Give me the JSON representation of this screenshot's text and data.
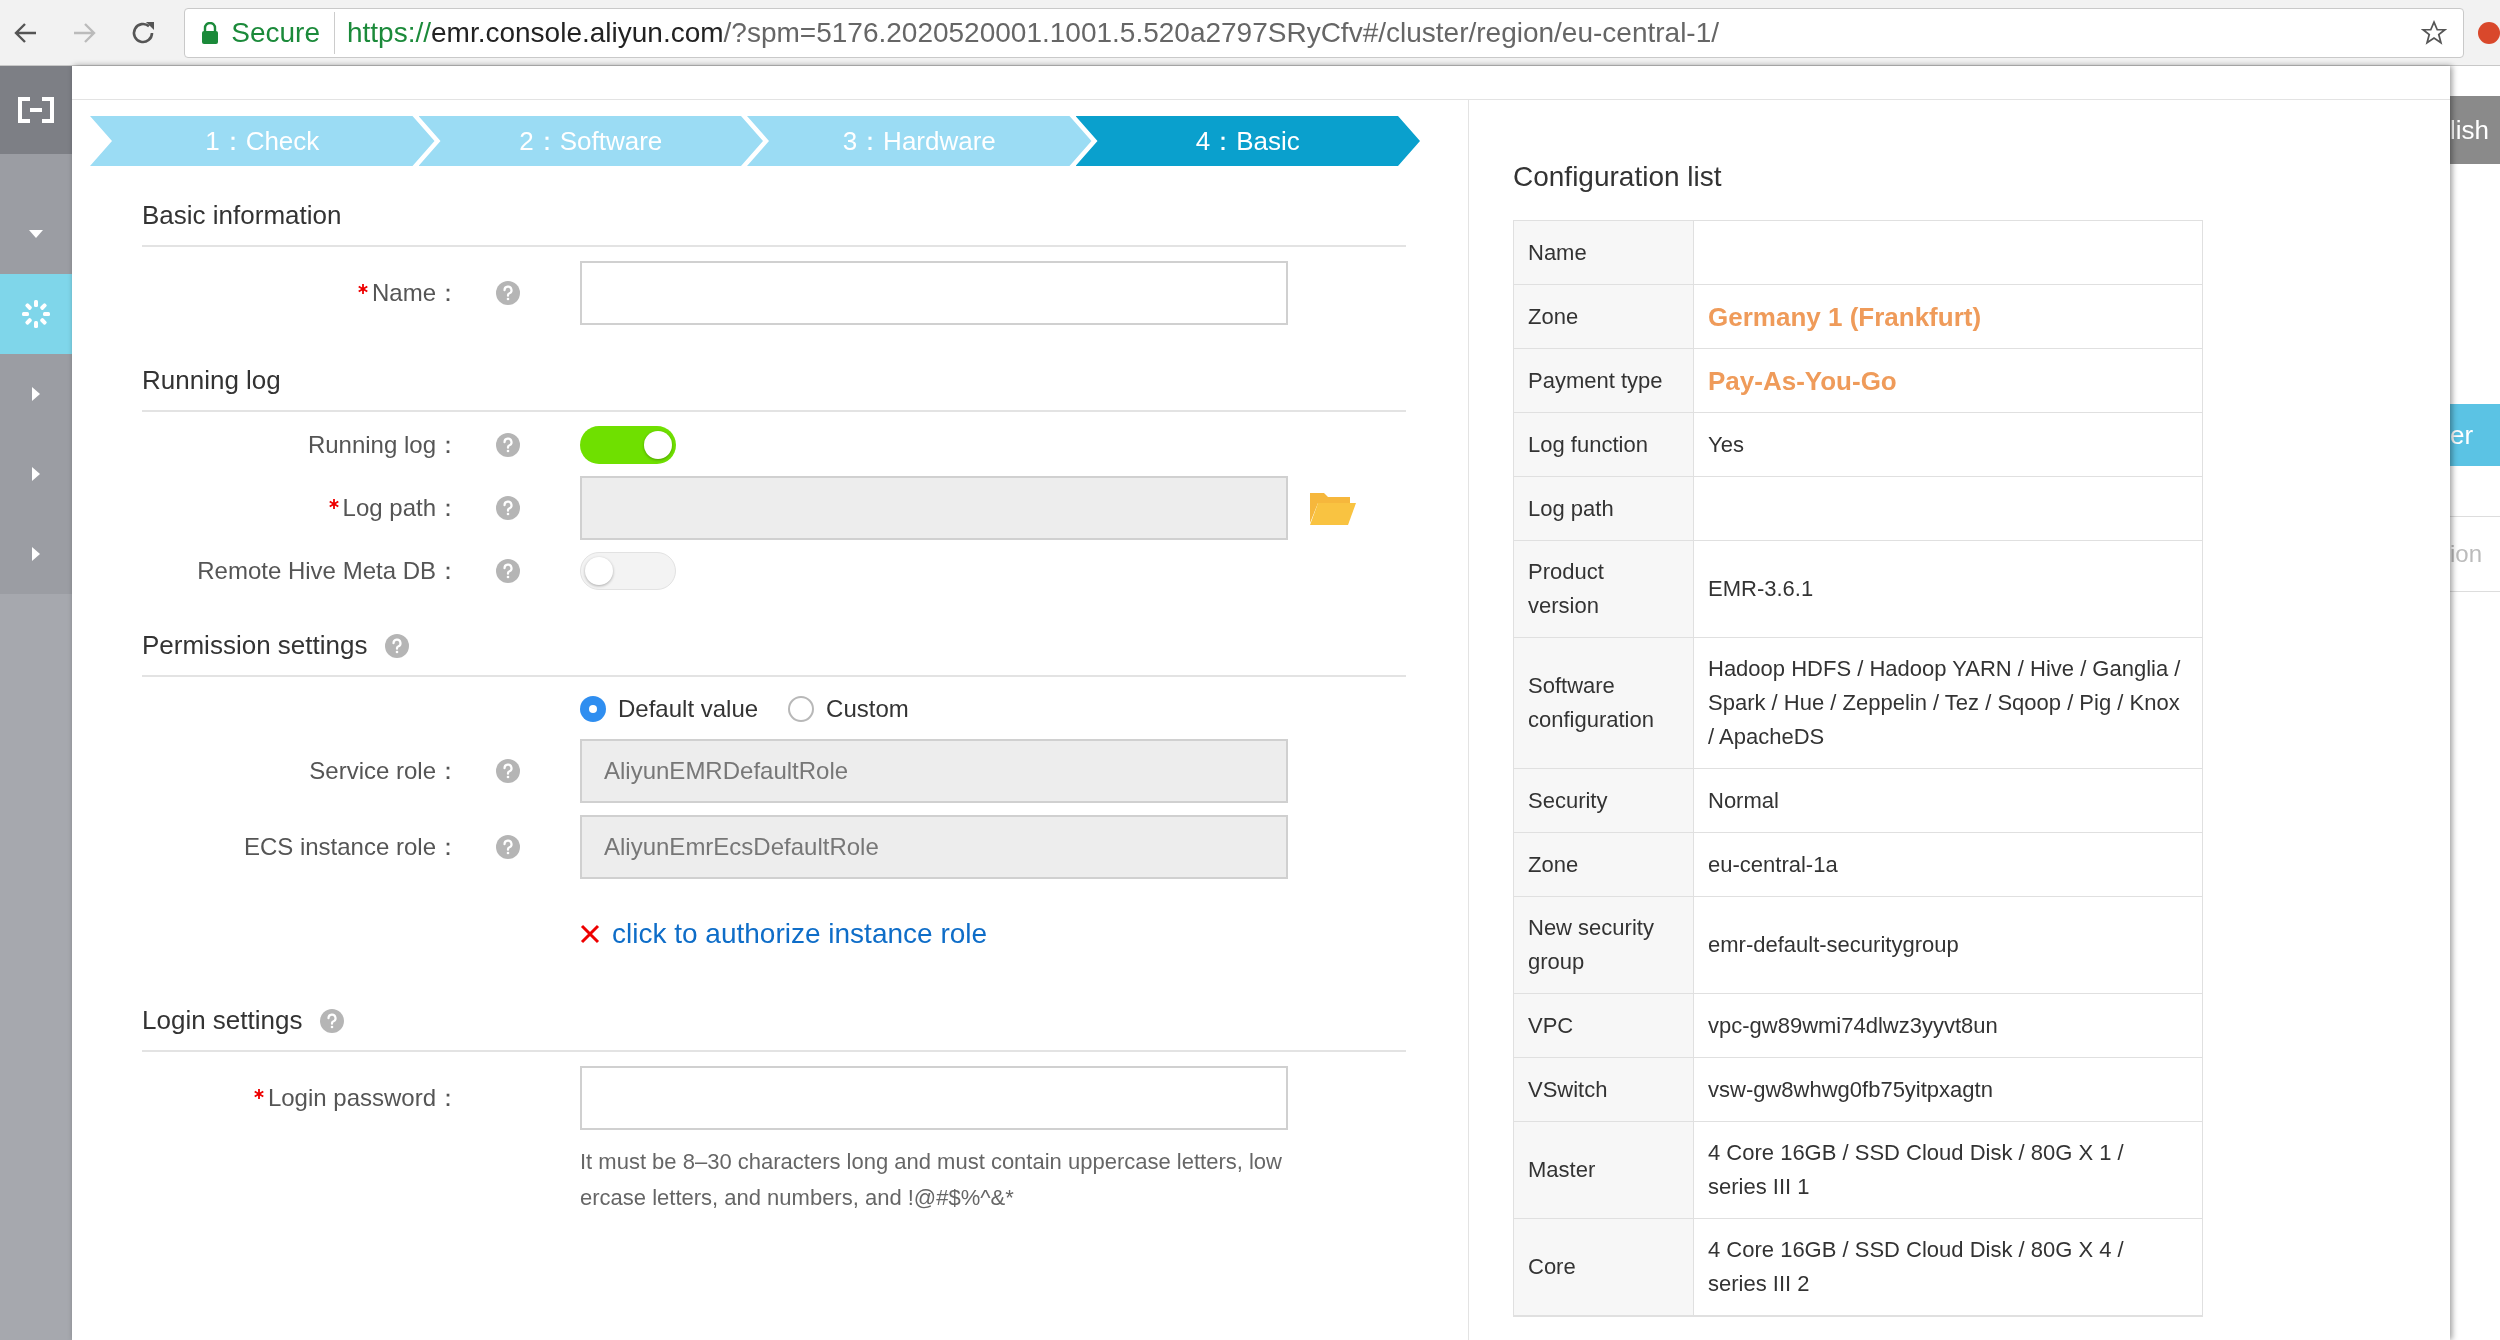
{
  "browser": {
    "secure_label": "Secure",
    "url_scheme": "https://",
    "url_host": "emr.console.aliyun.com",
    "url_path": "/?spm=5176.2020520001.1001.5.520a2797SRyCfv#/cluster/region/eu-central-1/"
  },
  "sidebar": {
    "items": [
      {
        "kind": "caret-down",
        "selected": false
      },
      {
        "kind": "loader",
        "selected": true
      },
      {
        "kind": "caret-right",
        "selected": false
      },
      {
        "kind": "caret-right",
        "selected": false
      },
      {
        "kind": "caret-right",
        "selected": false
      }
    ]
  },
  "steps": [
    {
      "label": "1：Check",
      "selected": false
    },
    {
      "label": "2：Software",
      "selected": false
    },
    {
      "label": "3：Hardware",
      "selected": false
    },
    {
      "label": "4：Basic",
      "selected": true
    }
  ],
  "form": {
    "sections": [
      {
        "title": "Basic information",
        "help": false,
        "fields": [
          {
            "kind": "text",
            "label": "Name：",
            "required": true,
            "help": true,
            "disabled": false
          }
        ]
      },
      {
        "title": "Running log",
        "help": false,
        "fields": [
          {
            "kind": "toggle",
            "label": "Running log：",
            "required": false,
            "help": true,
            "on": true
          },
          {
            "kind": "path",
            "label": "Log path：",
            "required": true,
            "help": true,
            "disabled": true
          },
          {
            "kind": "toggle",
            "label": "Remote Hive Meta DB：",
            "required": false,
            "help": true,
            "on": false
          }
        ]
      },
      {
        "title": "Permission settings",
        "help": true,
        "fields": [
          {
            "kind": "radio",
            "options": [
              {
                "label": "Default value",
                "selected": true
              },
              {
                "label": "Custom",
                "selected": false
              }
            ]
          },
          {
            "kind": "text",
            "label": "Service role：",
            "required": false,
            "help": true,
            "disabled": true,
            "value": "AliyunEMRDefaultRole"
          },
          {
            "kind": "text",
            "label": "ECS instance role：",
            "required": false,
            "help": true,
            "disabled": true,
            "value": "AliyunEmrEcsDefaultRole"
          },
          {
            "kind": "link",
            "text": "click to authorize instance role"
          }
        ]
      },
      {
        "title": "Login settings",
        "help": true,
        "fields": [
          {
            "kind": "text",
            "label": "Login password：",
            "required": true,
            "help": false,
            "disabled": false,
            "hint": "It must be 8–30 characters long and must contain uppercase letters, lowercase letters, and numbers, and !@#$%^&*"
          }
        ]
      }
    ]
  },
  "config_list": {
    "title": "Configuration list",
    "rows": [
      {
        "label": "Name"
      },
      {
        "label": "Zone",
        "value": "Germany 1 (Frankfurt)",
        "emphasis": true
      },
      {
        "label": "Payment type",
        "value": "Pay-As-You-Go",
        "emphasis": true
      },
      {
        "label": "Log function",
        "value": "Yes",
        "emphasis": false
      },
      {
        "label": "Log path"
      },
      {
        "label": "Product version",
        "value": "EMR-3.6.1",
        "emphasis": false
      },
      {
        "label": "Software configuration",
        "value": "Hadoop HDFS / Hadoop YARN / Hive / Ganglia / Spark / Hue / Zeppelin / Tez / Sqoop / Pig / Knox / ApacheDS",
        "emphasis": false
      },
      {
        "label": "Security",
        "value": "Normal",
        "emphasis": false
      },
      {
        "label": "Zone",
        "value": "eu-central-1a",
        "emphasis": false
      },
      {
        "label": "New security group",
        "value": "emr-default-securitygroup",
        "emphasis": false
      },
      {
        "label": "VPC",
        "value": "vpc-gw89wmi74dlwz3yyvt8un",
        "emphasis": false
      },
      {
        "label": "VSwitch",
        "value": "vsw-gw8whwg0fb75yitpxagtn",
        "emphasis": false
      },
      {
        "label": "Master",
        "value": "4 Core 16GB / SSD Cloud Disk / 80G X 1 / series III 1",
        "emphasis": false
      },
      {
        "label": "Core",
        "value": "4 Core 16GB / SSD Cloud Disk / 80G X 4 / series III 2",
        "emphasis": false
      }
    ]
  },
  "background_page": {
    "header_text": "lish",
    "button_text": "er",
    "row_text": "ion"
  }
}
